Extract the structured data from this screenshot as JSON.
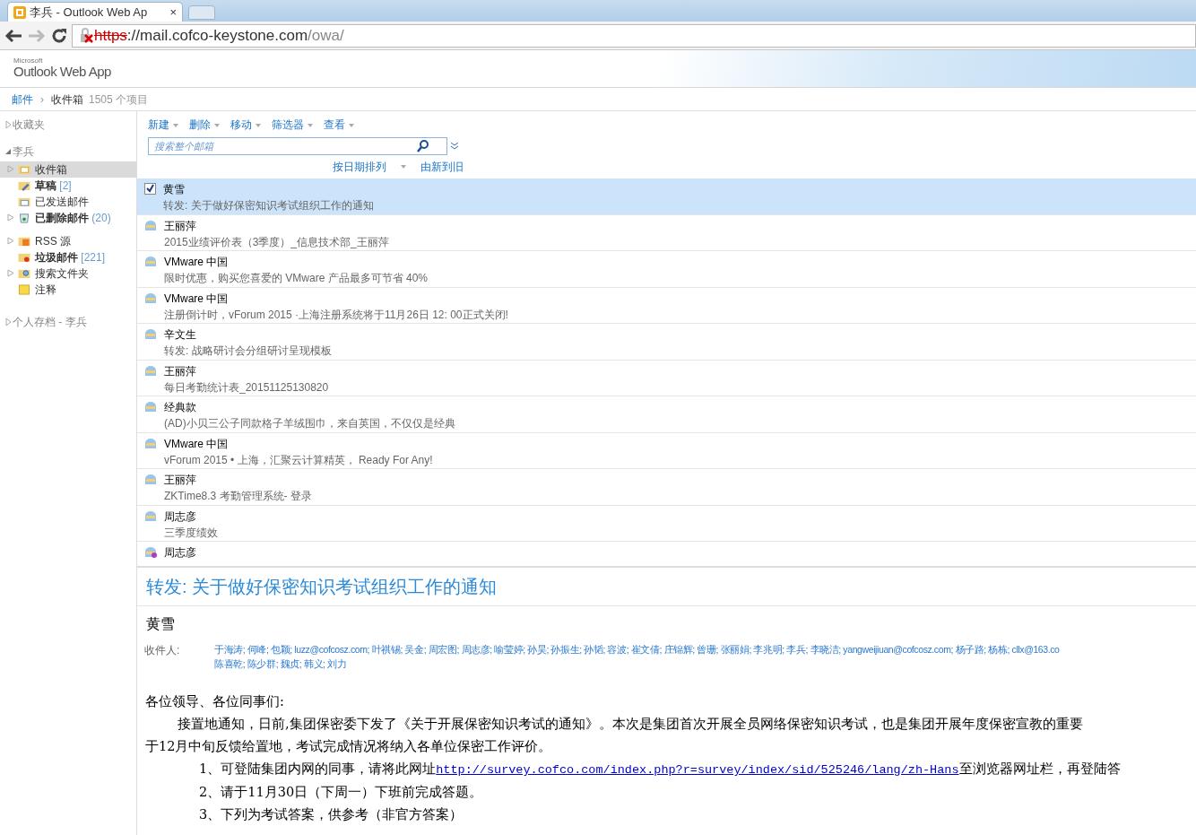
{
  "browser": {
    "tab_title": "李兵 - Outlook Web Ap",
    "tab_close": "×",
    "url_scheme": "https",
    "url_host": "://mail.cofco-keystone.com",
    "url_path": "/owa/"
  },
  "app": {
    "logo_small": "Microsoft",
    "logo": "Outlook Web App"
  },
  "breadcrumb": {
    "root": "邮件",
    "separator": "›",
    "folder": "收件箱",
    "count": "1505 个项目"
  },
  "sidebar": {
    "favorites": "收藏夹",
    "account": "李兵",
    "archive": "个人存档 - 李兵",
    "items": [
      {
        "label": "收件箱",
        "kind": "inbox",
        "expandable": true,
        "selected": true,
        "bold": false
      },
      {
        "label": "草稿",
        "count": "[2]",
        "kind": "drafts",
        "expandable": false,
        "selected": false,
        "bold": true
      },
      {
        "label": "已发送邮件",
        "kind": "sent",
        "expandable": false,
        "selected": false,
        "bold": false
      },
      {
        "label": "已删除邮件",
        "count": "(20)",
        "kind": "deleted",
        "expandable": true,
        "selected": false,
        "bold": true
      },
      {
        "label": "RSS 源",
        "kind": "rss",
        "expandable": true,
        "selected": false,
        "bold": false
      },
      {
        "label": "垃圾邮件",
        "count": "[221]",
        "kind": "junk",
        "expandable": false,
        "selected": false,
        "bold": true
      },
      {
        "label": "搜索文件夹",
        "kind": "search",
        "expandable": true,
        "selected": false,
        "bold": false
      },
      {
        "label": "注释",
        "kind": "notes",
        "expandable": false,
        "selected": false,
        "bold": false
      }
    ]
  },
  "toolbar": [
    "新建",
    "删除",
    "移动",
    "筛选器",
    "查看"
  ],
  "search": {
    "placeholder": "搜索整个邮箱"
  },
  "sort": {
    "by": "按日期排列",
    "order": "由新到旧"
  },
  "messages": [
    {
      "sender": "黄雪",
      "subject": "转发: 关于做好保密知识考试组织工作的通知",
      "kind": "checked",
      "selected": true
    },
    {
      "sender": "王丽萍",
      "subject": "2015业绩评价表（3季度）_信息技术部_王丽萍",
      "kind": "mail",
      "selected": false
    },
    {
      "sender": "VMware 中国",
      "subject": "限时优惠，购买您喜爱的 VMware 产品最多可节省 40%",
      "kind": "mail",
      "selected": false
    },
    {
      "sender": "VMware 中国",
      "subject": "注册倒计时，vForum 2015 ·上海注册系统将于11月26日 12: 00正式关闭!",
      "kind": "mail",
      "selected": false
    },
    {
      "sender": "辛文生",
      "subject": "转发: 战略研讨会分组研讨呈现模板",
      "kind": "mail",
      "selected": false
    },
    {
      "sender": "王丽萍",
      "subject": "每日考勤统计表_20151125130820",
      "kind": "mail",
      "selected": false
    },
    {
      "sender": "经典款",
      "subject": "(AD)小贝三公子同款格子羊绒围巾，来自英国，不仅仅是经典",
      "kind": "mail",
      "selected": false
    },
    {
      "sender": "VMware 中国",
      "subject": "vForum 2015 • 上海，汇聚云计算精英， Ready For Any!",
      "kind": "mail",
      "selected": false
    },
    {
      "sender": "王丽萍",
      "subject": "ZKTime8.3 考勤管理系统- 登录",
      "kind": "mail",
      "selected": false
    },
    {
      "sender": "周志彦",
      "subject": "三季度绩效",
      "kind": "mail",
      "selected": false
    },
    {
      "sender": "周志彦",
      "kind": "meeting",
      "selected": false
    }
  ],
  "reading": {
    "subject": "转发: 关于做好保密知识考试组织工作的通知",
    "sender": "黄雪",
    "to_label": "收件人:",
    "recipients": [
      "于海涛; 何峰; 包颖; luzz@cofcosz.com; 叶祺锡; 吴金; 周宏图; 周志彦; 喻莹婷; 孙昊; 孙振生; 孙韬; 容波; 崔文倩; 庄锦辉; 曾珊; 张丽娟; 李兆明; 李兵; 李晓洁; yangweijiuan@cofcosz.com; 杨子路; 杨栋; cllx@163.co",
      "陈喜乾; 陈少群; 魏贞; 韩义; 刘力"
    ],
    "body": [
      {
        "kind": "text",
        "text": "各位领导、各位同事们:"
      },
      {
        "kind": "indent",
        "text": "接置地通知，日前,集团保密委下发了《关于开展保密知识考试的通知》。本次是集团首次开展全员网络保密知识考试，也是集团开展年度保密宣教的重要"
      },
      {
        "kind": "text",
        "text": "于12月中旬反馈给置地，考试完成情况将纳入各单位保密工作评价。"
      },
      {
        "kind": "link",
        "before": "1、可登陆集团内网的同事，请将此网址",
        "link": "http://survey.cofco.com/index.php?r=survey/index/sid/525246/lang/zh-Hans",
        "after": "至浏览器网址栏，再登陆答"
      },
      {
        "kind": "item",
        "text": "2、请于11月30日（下周一）下班前完成答题。"
      },
      {
        "kind": "item",
        "text": "3、下列为考试答案，供参考（非官方答案）"
      }
    ]
  }
}
